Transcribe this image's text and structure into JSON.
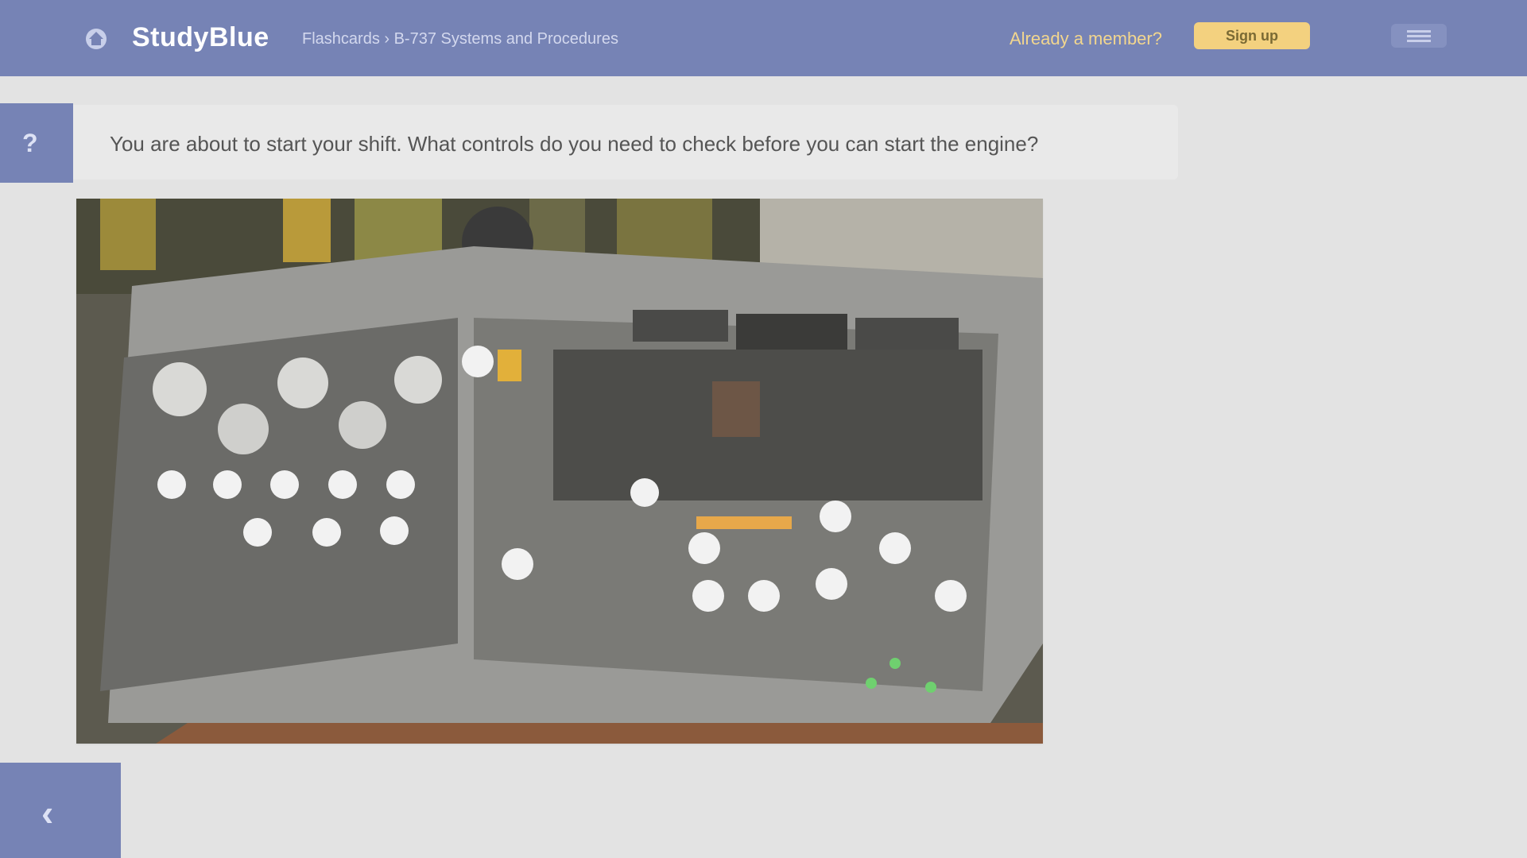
{
  "header": {
    "brand": "StudyBlue",
    "breadcrumb": "Flashcards › B-737 Systems and Procedures",
    "login_label": "Already a member?",
    "signup_label": "Sign up",
    "home_icon": "home-icon",
    "menu_icon": "hamburger-menu-icon"
  },
  "question": {
    "icon": "?",
    "text": "You are about to start your shift. What controls do you need to check before you can start the engine?"
  },
  "card_image": {
    "subject": "control-panel-photo"
  },
  "navigation": {
    "prev_icon": "‹"
  },
  "colors": {
    "primary": "#7683b5",
    "accent": "#f3d17f",
    "background": "#e3e3e3"
  }
}
